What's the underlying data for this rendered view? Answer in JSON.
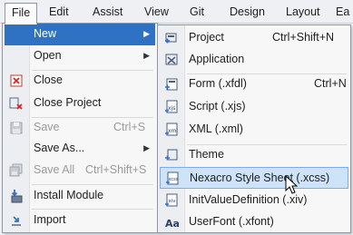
{
  "menubar": {
    "items": [
      "File",
      "Edit",
      "Assist",
      "View",
      "Git",
      "Design",
      "Layout",
      "Ea"
    ]
  },
  "file_menu": {
    "new": "New",
    "open": "Open",
    "close": "Close",
    "close_project": "Close Project",
    "save": "Save",
    "save_shortcut": "Ctrl+S",
    "save_as": "Save As...",
    "save_all": "Save All",
    "save_all_shortcut": "Ctrl+Shift+S",
    "install_module": "Install Module",
    "import": "Import"
  },
  "new_submenu": {
    "project": "Project",
    "project_shortcut": "Ctrl+Shift+N",
    "application": "Application",
    "form": "Form (.xfdl)",
    "form_shortcut": "Ctrl+N",
    "script": "Script (.xjs)",
    "xml": "XML (.xml)",
    "theme": "Theme",
    "style_sheet": "Nexacro Style Sheet (.xcss)",
    "init_value": "InitValueDefinition (.xiv)",
    "user_font": "UserFont (.xfont)"
  },
  "colors": {
    "highlight": "#2f72c4",
    "hover": "#cfe3f8",
    "menu_bg": "#f7f7f7"
  }
}
